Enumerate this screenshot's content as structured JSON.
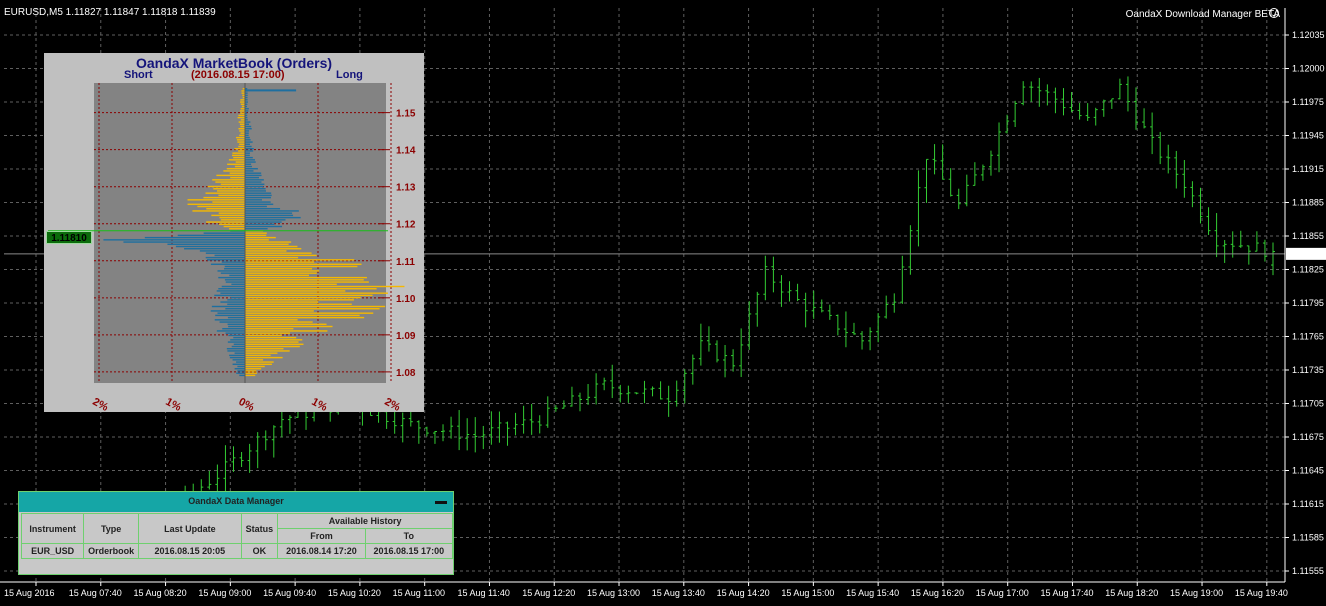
{
  "header": {
    "symbol_info": "EURUSD,M5  1.11827 1.11847 1.11818 1.11839",
    "plugin_name": "OandaX Download Manager BETA"
  },
  "price_axis": {
    "labels": [
      "1.12035",
      "1.12000",
      "1.11975",
      "1.11945",
      "1.11915",
      "1.11885",
      "1.11855",
      "1.11825",
      "1.11795",
      "1.11765",
      "1.11735",
      "1.11705",
      "1.11675",
      "1.11645",
      "1.11615",
      "1.11585",
      "1.11555"
    ],
    "current_price": "1.11839"
  },
  "time_axis": {
    "labels": [
      "15 Aug 2016",
      "15 Aug 07:40",
      "15 Aug 08:20",
      "15 Aug 09:00",
      "15 Aug 09:40",
      "15 Aug 10:20",
      "15 Aug 11:00",
      "15 Aug 11:40",
      "15 Aug 12:20",
      "15 Aug 13:00",
      "15 Aug 13:40",
      "15 Aug 14:20",
      "15 Aug 15:00",
      "15 Aug 15:40",
      "15 Aug 16:20",
      "15 Aug 17:00",
      "15 Aug 17:40",
      "15 Aug 18:20",
      "15 Aug 19:00",
      "15 Aug 19:40"
    ]
  },
  "colors": {
    "background": "#000000",
    "grid": "#5f5f5f",
    "bars": "#33cc33",
    "short_bars": "#1e6fa0",
    "long_bars": "#f5b800",
    "book_bg": "#838383",
    "book_grid": "#8b0000"
  },
  "market_book": {
    "title": "OandaX MarketBook  (Orders)",
    "short_label": "Short",
    "long_label": "Long",
    "date": "(2016.08.15 17:00)",
    "price_tag": "1.11810",
    "price_labels": [
      "1.15",
      "1.14",
      "1.13",
      "1.12",
      "1.11",
      "1.10",
      "1.09",
      "1.08"
    ],
    "pct_labels": [
      "2%",
      "1%",
      "0%",
      "1%",
      "2%"
    ]
  },
  "data_manager": {
    "title": "OandaX Data Manager",
    "columns": [
      "Instrument",
      "Type",
      "Last Update",
      "Status",
      "From",
      "To"
    ],
    "group_header": "Available History",
    "rows": [
      [
        "EUR_USD",
        "Orderbook",
        "2016.08.15 20:05",
        "OK",
        "2016.08.14 17:20",
        "2016.08.15 17:00"
      ]
    ]
  },
  "chart_data": {
    "type": "ohlc",
    "symbol": "EURUSD",
    "timeframe": "M5",
    "last": {
      "open": 1.11827,
      "high": 1.11847,
      "low": 1.11818,
      "close": 1.11839
    },
    "ylim": [
      1.11545,
      1.12045
    ],
    "grid": true,
    "x_start": "2016-08-15 07:00",
    "x_end": "2016-08-15 19:55",
    "bar_count": 156,
    "close_anchors": [
      {
        "time": "07:00",
        "price": 1.1159
      },
      {
        "time": "08:20",
        "price": 1.116
      },
      {
        "time": "09:00",
        "price": 1.1164
      },
      {
        "time": "09:40",
        "price": 1.1169
      },
      {
        "time": "10:20",
        "price": 1.11705
      },
      {
        "time": "11:00",
        "price": 1.11685
      },
      {
        "time": "11:40",
        "price": 1.11675
      },
      {
        "time": "12:20",
        "price": 1.1169
      },
      {
        "time": "13:00",
        "price": 1.1172
      },
      {
        "time": "13:40",
        "price": 1.1171
      },
      {
        "time": "14:00",
        "price": 1.11755
      },
      {
        "time": "14:20",
        "price": 1.1174
      },
      {
        "time": "14:40",
        "price": 1.1182
      },
      {
        "time": "15:00",
        "price": 1.11795
      },
      {
        "time": "15:40",
        "price": 1.1176
      },
      {
        "time": "16:00",
        "price": 1.118
      },
      {
        "time": "16:20",
        "price": 1.11925
      },
      {
        "time": "16:40",
        "price": 1.1188
      },
      {
        "time": "17:00",
        "price": 1.1193
      },
      {
        "time": "17:20",
        "price": 1.1199
      },
      {
        "time": "17:40",
        "price": 1.11975
      },
      {
        "time": "18:00",
        "price": 1.11955
      },
      {
        "time": "18:20",
        "price": 1.11985
      },
      {
        "time": "18:40",
        "price": 1.11935
      },
      {
        "time": "19:00",
        "price": 1.119
      },
      {
        "time": "19:20",
        "price": 1.1185
      },
      {
        "time": "19:55",
        "price": 1.11839
      }
    ],
    "orderbook": {
      "price_range": [
        1.077,
        1.158
      ],
      "pct_range": [
        -2,
        2
      ],
      "current_price": 1.1181,
      "short_profile": [
        {
          "price": 1.155,
          "pct": 0.05
        },
        {
          "price": 1.15,
          "pct": 0.08
        },
        {
          "price": 1.145,
          "pct": 0.1
        },
        {
          "price": 1.14,
          "pct": 0.15
        },
        {
          "price": 1.135,
          "pct": 0.25
        },
        {
          "price": 1.13,
          "pct": 0.45
        },
        {
          "price": 1.125,
          "pct": 0.7
        },
        {
          "price": 1.121,
          "pct": 0.6
        },
        {
          "price": 1.118,
          "pct": 0.3
        },
        {
          "price": 1.116,
          "pct": 1.8
        },
        {
          "price": 1.114,
          "pct": 0.9
        },
        {
          "price": 1.112,
          "pct": 0.6
        },
        {
          "price": 1.109,
          "pct": 0.4
        },
        {
          "price": 1.105,
          "pct": 0.3
        },
        {
          "price": 1.1,
          "pct": 0.35
        },
        {
          "price": 1.095,
          "pct": 0.4
        },
        {
          "price": 1.09,
          "pct": 0.3
        },
        {
          "price": 1.085,
          "pct": 0.2
        },
        {
          "price": 1.08,
          "pct": 0.1
        }
      ],
      "long_profile": [
        {
          "price": 1.155,
          "pct": 0.03
        },
        {
          "price": 1.15,
          "pct": 0.05
        },
        {
          "price": 1.145,
          "pct": 0.08
        },
        {
          "price": 1.14,
          "pct": 0.1
        },
        {
          "price": 1.135,
          "pct": 0.15
        },
        {
          "price": 1.13,
          "pct": 0.25
        },
        {
          "price": 1.125,
          "pct": 0.45
        },
        {
          "price": 1.121,
          "pct": 0.9
        },
        {
          "price": 1.118,
          "pct": 0.4
        },
        {
          "price": 1.115,
          "pct": 0.6
        },
        {
          "price": 1.112,
          "pct": 0.85
        },
        {
          "price": 1.11,
          "pct": 1.3
        },
        {
          "price": 1.106,
          "pct": 1.4
        },
        {
          "price": 1.103,
          "pct": 1.8
        },
        {
          "price": 1.101,
          "pct": 2.0
        },
        {
          "price": 1.098,
          "pct": 1.6
        },
        {
          "price": 1.095,
          "pct": 1.4
        },
        {
          "price": 1.092,
          "pct": 1.0
        },
        {
          "price": 1.088,
          "pct": 0.8
        },
        {
          "price": 1.084,
          "pct": 0.5
        },
        {
          "price": 1.08,
          "pct": 0.2
        }
      ],
      "highlight_short": {
        "price": 1.156,
        "pct": 0.7
      }
    }
  }
}
